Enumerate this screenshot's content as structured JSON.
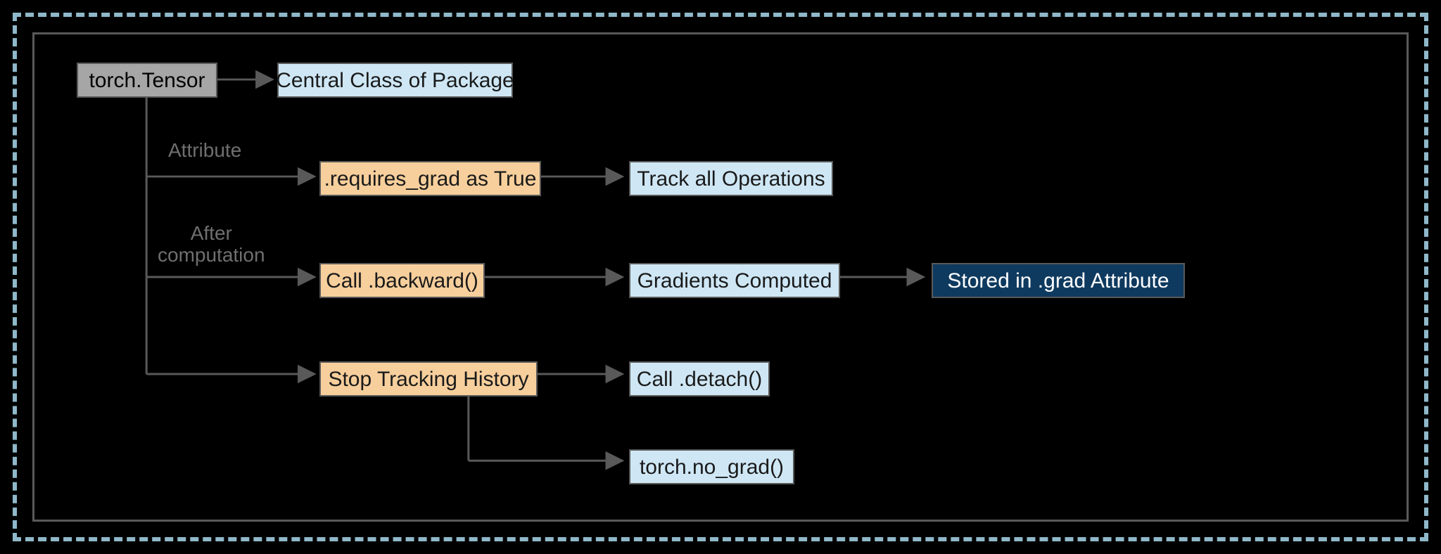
{
  "nodes": {
    "tensor": {
      "label": "torch.Tensor"
    },
    "central": {
      "label": "Central Class of Package"
    },
    "requires_grad": {
      "label": ".requires_grad as True"
    },
    "track_ops": {
      "label": "Track all Operations"
    },
    "backward": {
      "label": "Call .backward()"
    },
    "grad_computed": {
      "label": "Gradients Computed"
    },
    "stored_grad": {
      "label": "Stored in .grad Attribute"
    },
    "stop_tracking": {
      "label": "Stop Tracking History"
    },
    "detach": {
      "label": "Call .detach()"
    },
    "no_grad": {
      "label": "torch.no_grad()"
    }
  },
  "edge_labels": {
    "attribute": "Attribute",
    "after_computation": "After\ncomputation"
  },
  "colors": {
    "gray": "#a6a6a6",
    "blue": "#cfe7f5",
    "orange": "#f7cf9c",
    "dark": "#0f3a5f",
    "line": "#595959",
    "border_dashed": "#8fb8c9"
  }
}
